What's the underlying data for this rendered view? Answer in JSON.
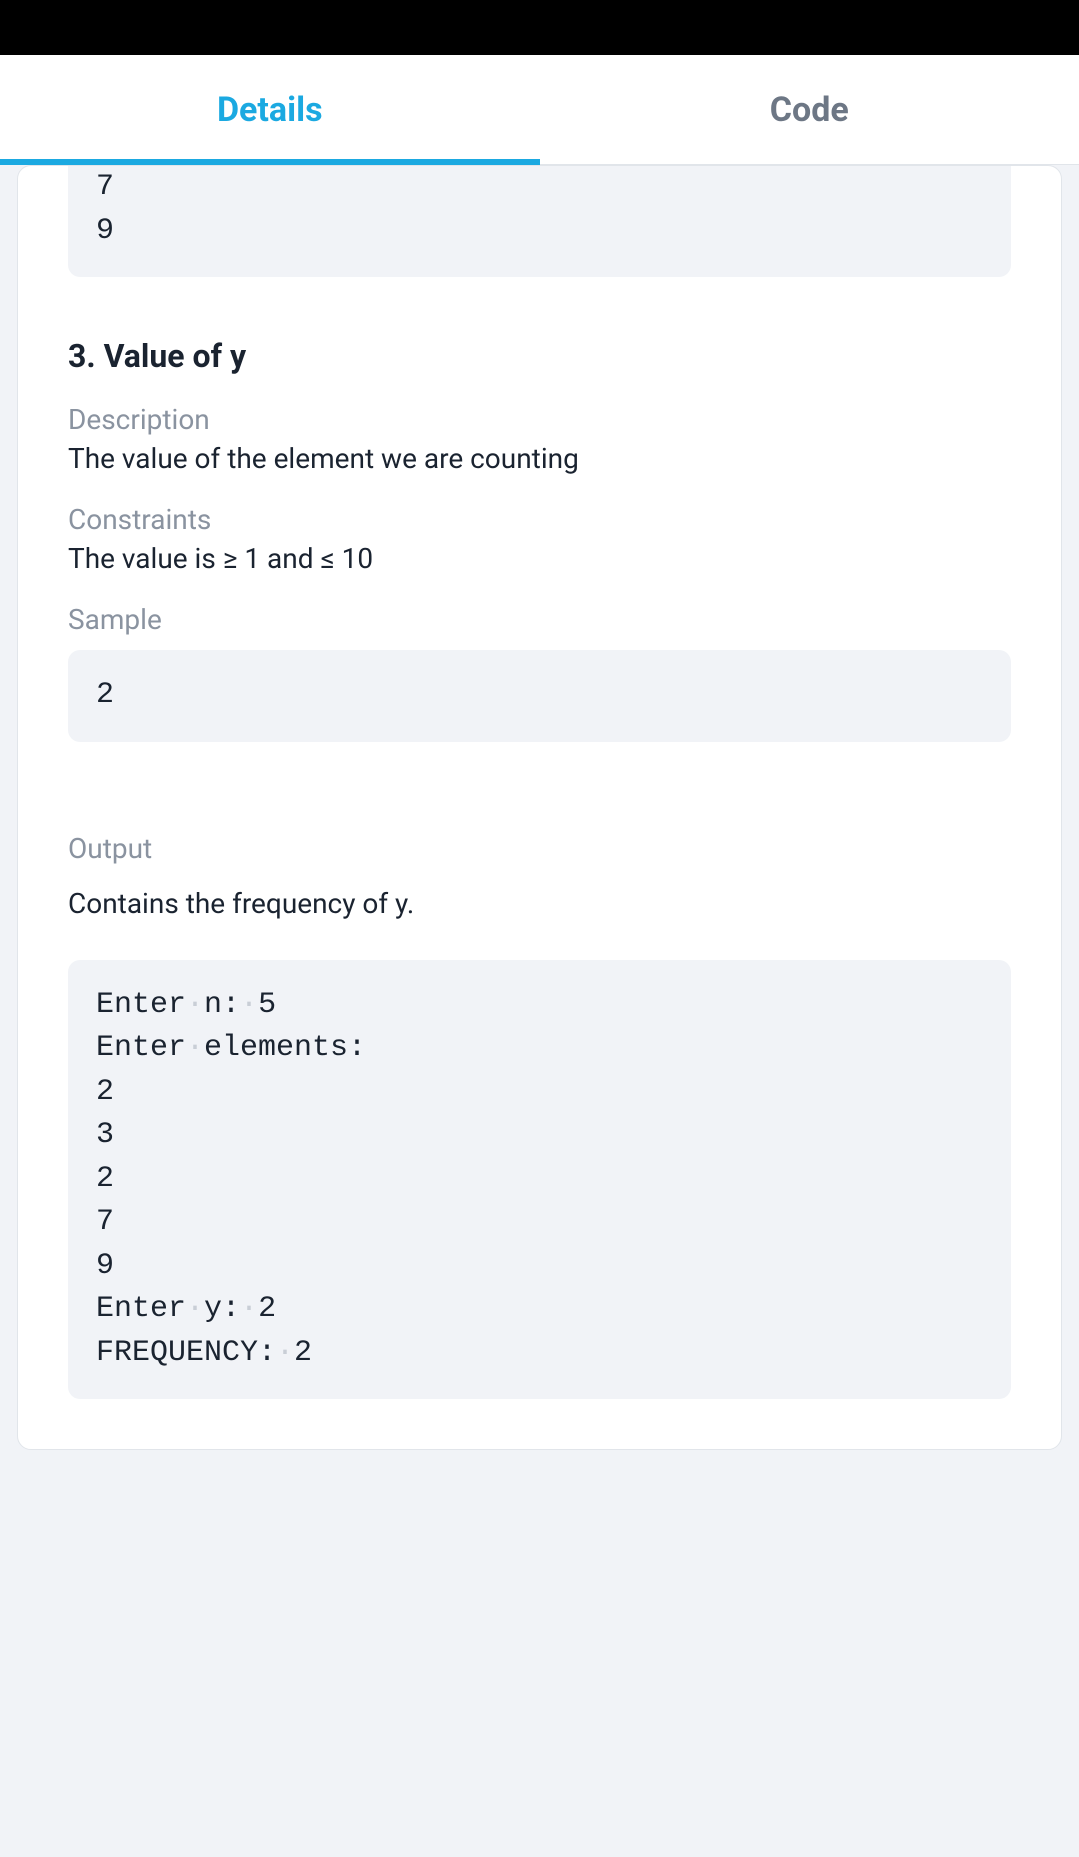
{
  "tabs": {
    "details": "Details",
    "code": "Code"
  },
  "top_sample": "7\n9",
  "section3": {
    "heading": "3. Value of y",
    "desc_label": "Description",
    "desc_text": "The value of the element we are counting",
    "constraints_label": "Constraints",
    "constraints_text": "The value is ≥ 1 and ≤ 10",
    "sample_label": "Sample",
    "sample_value": "2"
  },
  "output": {
    "label": "Output",
    "desc": "Contains the frequency of y.",
    "sample_segments": [
      {
        "t": "Enter"
      },
      {
        "t": "·",
        "sp": true
      },
      {
        "t": "n:"
      },
      {
        "t": "·",
        "sp": true
      },
      {
        "t": "5\n"
      },
      {
        "t": "Enter"
      },
      {
        "t": "·",
        "sp": true
      },
      {
        "t": "elements:\n"
      },
      {
        "t": "2\n"
      },
      {
        "t": "3\n"
      },
      {
        "t": "2\n"
      },
      {
        "t": "7\n"
      },
      {
        "t": "9\n"
      },
      {
        "t": "Enter"
      },
      {
        "t": "·",
        "sp": true
      },
      {
        "t": "y:"
      },
      {
        "t": "·",
        "sp": true
      },
      {
        "t": "2\n"
      },
      {
        "t": "FREQUENCY:"
      },
      {
        "t": "·",
        "sp": true
      },
      {
        "t": "2"
      }
    ]
  }
}
